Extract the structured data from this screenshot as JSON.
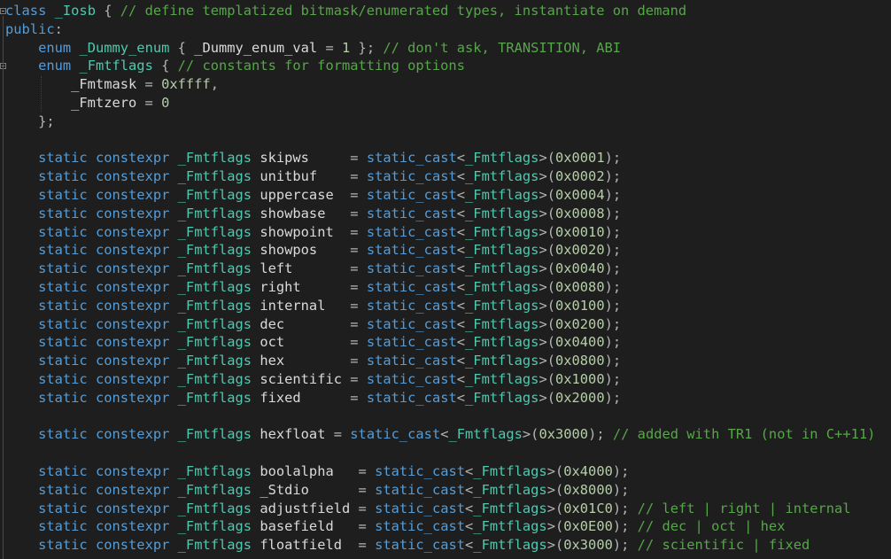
{
  "editor": {
    "colors": {
      "background": "#1e1e1e",
      "keyword": "#569cd6",
      "type": "#4ec9b0",
      "comment": "#57a64a",
      "number": "#b5cea8",
      "text": "#dadada"
    },
    "lines": [
      [
        [
          "kw",
          "class"
        ],
        [
          "var",
          " "
        ],
        [
          "type",
          "_Iosb"
        ],
        [
          "punc",
          " { "
        ],
        [
          "com",
          "// define templatized bitmask/enumerated types, instantiate on demand"
        ]
      ],
      [
        [
          "kw",
          "public"
        ],
        [
          "punc",
          ":"
        ]
      ],
      [
        [
          "var",
          "    "
        ],
        [
          "kw",
          "enum"
        ],
        [
          "var",
          " "
        ],
        [
          "type",
          "_Dummy_enum"
        ],
        [
          "punc",
          " { "
        ],
        [
          "var",
          "_Dummy_enum_val"
        ],
        [
          "punc",
          " = "
        ],
        [
          "num",
          "1"
        ],
        [
          "punc",
          " }; "
        ],
        [
          "com",
          "// don't ask, TRANSITION, ABI"
        ]
      ],
      [
        [
          "var",
          "    "
        ],
        [
          "kw",
          "enum"
        ],
        [
          "var",
          " "
        ],
        [
          "type",
          "_Fmtflags"
        ],
        [
          "punc",
          " { "
        ],
        [
          "com",
          "// constants for formatting options"
        ]
      ],
      [
        [
          "var",
          "        _Fmtmask"
        ],
        [
          "punc",
          " = "
        ],
        [
          "num",
          "0xffff"
        ],
        [
          "punc",
          ","
        ]
      ],
      [
        [
          "var",
          "        _Fmtzero"
        ],
        [
          "punc",
          " = "
        ],
        [
          "num",
          "0"
        ]
      ],
      [
        [
          "punc",
          "    };"
        ]
      ],
      [],
      [
        [
          "var",
          "    "
        ],
        [
          "kw",
          "static"
        ],
        [
          "var",
          " "
        ],
        [
          "kw",
          "constexpr"
        ],
        [
          "var",
          " "
        ],
        [
          "type",
          "_Fmtflags"
        ],
        [
          "var",
          " skipws     "
        ],
        [
          "punc",
          "= "
        ],
        [
          "kw",
          "static_cast"
        ],
        [
          "punc",
          "<"
        ],
        [
          "type",
          "_Fmtflags"
        ],
        [
          "punc",
          ">("
        ],
        [
          "num",
          "0x0001"
        ],
        [
          "punc",
          ");"
        ]
      ],
      [
        [
          "var",
          "    "
        ],
        [
          "kw",
          "static"
        ],
        [
          "var",
          " "
        ],
        [
          "kw",
          "constexpr"
        ],
        [
          "var",
          " "
        ],
        [
          "type",
          "_Fmtflags"
        ],
        [
          "var",
          " unitbuf    "
        ],
        [
          "punc",
          "= "
        ],
        [
          "kw",
          "static_cast"
        ],
        [
          "punc",
          "<"
        ],
        [
          "type",
          "_Fmtflags"
        ],
        [
          "punc",
          ">("
        ],
        [
          "num",
          "0x0002"
        ],
        [
          "punc",
          ");"
        ]
      ],
      [
        [
          "var",
          "    "
        ],
        [
          "kw",
          "static"
        ],
        [
          "var",
          " "
        ],
        [
          "kw",
          "constexpr"
        ],
        [
          "var",
          " "
        ],
        [
          "type",
          "_Fmtflags"
        ],
        [
          "var",
          " uppercase  "
        ],
        [
          "punc",
          "= "
        ],
        [
          "kw",
          "static_cast"
        ],
        [
          "punc",
          "<"
        ],
        [
          "type",
          "_Fmtflags"
        ],
        [
          "punc",
          ">("
        ],
        [
          "num",
          "0x0004"
        ],
        [
          "punc",
          ");"
        ]
      ],
      [
        [
          "var",
          "    "
        ],
        [
          "kw",
          "static"
        ],
        [
          "var",
          " "
        ],
        [
          "kw",
          "constexpr"
        ],
        [
          "var",
          " "
        ],
        [
          "type",
          "_Fmtflags"
        ],
        [
          "var",
          " showbase   "
        ],
        [
          "punc",
          "= "
        ],
        [
          "kw",
          "static_cast"
        ],
        [
          "punc",
          "<"
        ],
        [
          "type",
          "_Fmtflags"
        ],
        [
          "punc",
          ">("
        ],
        [
          "num",
          "0x0008"
        ],
        [
          "punc",
          ");"
        ]
      ],
      [
        [
          "var",
          "    "
        ],
        [
          "kw",
          "static"
        ],
        [
          "var",
          " "
        ],
        [
          "kw",
          "constexpr"
        ],
        [
          "var",
          " "
        ],
        [
          "type",
          "_Fmtflags"
        ],
        [
          "var",
          " showpoint  "
        ],
        [
          "punc",
          "= "
        ],
        [
          "kw",
          "static_cast"
        ],
        [
          "punc",
          "<"
        ],
        [
          "type",
          "_Fmtflags"
        ],
        [
          "punc",
          ">("
        ],
        [
          "num",
          "0x0010"
        ],
        [
          "punc",
          ");"
        ]
      ],
      [
        [
          "var",
          "    "
        ],
        [
          "kw",
          "static"
        ],
        [
          "var",
          " "
        ],
        [
          "kw",
          "constexpr"
        ],
        [
          "var",
          " "
        ],
        [
          "type",
          "_Fmtflags"
        ],
        [
          "var",
          " showpos    "
        ],
        [
          "punc",
          "= "
        ],
        [
          "kw",
          "static_cast"
        ],
        [
          "punc",
          "<"
        ],
        [
          "type",
          "_Fmtflags"
        ],
        [
          "punc",
          ">("
        ],
        [
          "num",
          "0x0020"
        ],
        [
          "punc",
          ");"
        ]
      ],
      [
        [
          "var",
          "    "
        ],
        [
          "kw",
          "static"
        ],
        [
          "var",
          " "
        ],
        [
          "kw",
          "constexpr"
        ],
        [
          "var",
          " "
        ],
        [
          "type",
          "_Fmtflags"
        ],
        [
          "var",
          " left       "
        ],
        [
          "punc",
          "= "
        ],
        [
          "kw",
          "static_cast"
        ],
        [
          "punc",
          "<"
        ],
        [
          "type",
          "_Fmtflags"
        ],
        [
          "punc",
          ">("
        ],
        [
          "num",
          "0x0040"
        ],
        [
          "punc",
          ");"
        ]
      ],
      [
        [
          "var",
          "    "
        ],
        [
          "kw",
          "static"
        ],
        [
          "var",
          " "
        ],
        [
          "kw",
          "constexpr"
        ],
        [
          "var",
          " "
        ],
        [
          "type",
          "_Fmtflags"
        ],
        [
          "var",
          " right      "
        ],
        [
          "punc",
          "= "
        ],
        [
          "kw",
          "static_cast"
        ],
        [
          "punc",
          "<"
        ],
        [
          "type",
          "_Fmtflags"
        ],
        [
          "punc",
          ">("
        ],
        [
          "num",
          "0x0080"
        ],
        [
          "punc",
          ");"
        ]
      ],
      [
        [
          "var",
          "    "
        ],
        [
          "kw",
          "static"
        ],
        [
          "var",
          " "
        ],
        [
          "kw",
          "constexpr"
        ],
        [
          "var",
          " "
        ],
        [
          "type",
          "_Fmtflags"
        ],
        [
          "var",
          " internal   "
        ],
        [
          "punc",
          "= "
        ],
        [
          "kw",
          "static_cast"
        ],
        [
          "punc",
          "<"
        ],
        [
          "type",
          "_Fmtflags"
        ],
        [
          "punc",
          ">("
        ],
        [
          "num",
          "0x0100"
        ],
        [
          "punc",
          ");"
        ]
      ],
      [
        [
          "var",
          "    "
        ],
        [
          "kw",
          "static"
        ],
        [
          "var",
          " "
        ],
        [
          "kw",
          "constexpr"
        ],
        [
          "var",
          " "
        ],
        [
          "type",
          "_Fmtflags"
        ],
        [
          "var",
          " dec        "
        ],
        [
          "punc",
          "= "
        ],
        [
          "kw",
          "static_cast"
        ],
        [
          "punc",
          "<"
        ],
        [
          "type",
          "_Fmtflags"
        ],
        [
          "punc",
          ">("
        ],
        [
          "num",
          "0x0200"
        ],
        [
          "punc",
          ");"
        ]
      ],
      [
        [
          "var",
          "    "
        ],
        [
          "kw",
          "static"
        ],
        [
          "var",
          " "
        ],
        [
          "kw",
          "constexpr"
        ],
        [
          "var",
          " "
        ],
        [
          "type",
          "_Fmtflags"
        ],
        [
          "var",
          " oct        "
        ],
        [
          "punc",
          "= "
        ],
        [
          "kw",
          "static_cast"
        ],
        [
          "punc",
          "<"
        ],
        [
          "type",
          "_Fmtflags"
        ],
        [
          "punc",
          ">("
        ],
        [
          "num",
          "0x0400"
        ],
        [
          "punc",
          ");"
        ]
      ],
      [
        [
          "var",
          "    "
        ],
        [
          "kw",
          "static"
        ],
        [
          "var",
          " "
        ],
        [
          "kw",
          "constexpr"
        ],
        [
          "var",
          " "
        ],
        [
          "type",
          "_Fmtflags"
        ],
        [
          "var",
          " hex        "
        ],
        [
          "punc",
          "= "
        ],
        [
          "kw",
          "static_cast"
        ],
        [
          "punc",
          "<"
        ],
        [
          "type",
          "_Fmtflags"
        ],
        [
          "punc",
          ">("
        ],
        [
          "num",
          "0x0800"
        ],
        [
          "punc",
          ");"
        ]
      ],
      [
        [
          "var",
          "    "
        ],
        [
          "kw",
          "static"
        ],
        [
          "var",
          " "
        ],
        [
          "kw",
          "constexpr"
        ],
        [
          "var",
          " "
        ],
        [
          "type",
          "_Fmtflags"
        ],
        [
          "var",
          " scientific "
        ],
        [
          "punc",
          "= "
        ],
        [
          "kw",
          "static_cast"
        ],
        [
          "punc",
          "<"
        ],
        [
          "type",
          "_Fmtflags"
        ],
        [
          "punc",
          ">("
        ],
        [
          "num",
          "0x1000"
        ],
        [
          "punc",
          ");"
        ]
      ],
      [
        [
          "var",
          "    "
        ],
        [
          "kw",
          "static"
        ],
        [
          "var",
          " "
        ],
        [
          "kw",
          "constexpr"
        ],
        [
          "var",
          " "
        ],
        [
          "type",
          "_Fmtflags"
        ],
        [
          "var",
          " fixed      "
        ],
        [
          "punc",
          "= "
        ],
        [
          "kw",
          "static_cast"
        ],
        [
          "punc",
          "<"
        ],
        [
          "type",
          "_Fmtflags"
        ],
        [
          "punc",
          ">("
        ],
        [
          "num",
          "0x2000"
        ],
        [
          "punc",
          ");"
        ]
      ],
      [],
      [
        [
          "var",
          "    "
        ],
        [
          "kw",
          "static"
        ],
        [
          "var",
          " "
        ],
        [
          "kw",
          "constexpr"
        ],
        [
          "var",
          " "
        ],
        [
          "type",
          "_Fmtflags"
        ],
        [
          "var",
          " hexfloat "
        ],
        [
          "punc",
          "= "
        ],
        [
          "kw",
          "static_cast"
        ],
        [
          "punc",
          "<"
        ],
        [
          "type",
          "_Fmtflags"
        ],
        [
          "punc",
          ">("
        ],
        [
          "num",
          "0x3000"
        ],
        [
          "punc",
          "); "
        ],
        [
          "com",
          "// added with TR1 (not in C++11)"
        ]
      ],
      [],
      [
        [
          "var",
          "    "
        ],
        [
          "kw",
          "static"
        ],
        [
          "var",
          " "
        ],
        [
          "kw",
          "constexpr"
        ],
        [
          "var",
          " "
        ],
        [
          "type",
          "_Fmtflags"
        ],
        [
          "var",
          " boolalpha   "
        ],
        [
          "punc",
          "= "
        ],
        [
          "kw",
          "static_cast"
        ],
        [
          "punc",
          "<"
        ],
        [
          "type",
          "_Fmtflags"
        ],
        [
          "punc",
          ">("
        ],
        [
          "num",
          "0x4000"
        ],
        [
          "punc",
          ");"
        ]
      ],
      [
        [
          "var",
          "    "
        ],
        [
          "kw",
          "static"
        ],
        [
          "var",
          " "
        ],
        [
          "kw",
          "constexpr"
        ],
        [
          "var",
          " "
        ],
        [
          "type",
          "_Fmtflags"
        ],
        [
          "var",
          " _Stdio      "
        ],
        [
          "punc",
          "= "
        ],
        [
          "kw",
          "static_cast"
        ],
        [
          "punc",
          "<"
        ],
        [
          "type",
          "_Fmtflags"
        ],
        [
          "punc",
          ">("
        ],
        [
          "num",
          "0x8000"
        ],
        [
          "punc",
          ");"
        ]
      ],
      [
        [
          "var",
          "    "
        ],
        [
          "kw",
          "static"
        ],
        [
          "var",
          " "
        ],
        [
          "kw",
          "constexpr"
        ],
        [
          "var",
          " "
        ],
        [
          "type",
          "_Fmtflags"
        ],
        [
          "var",
          " adjustfield "
        ],
        [
          "punc",
          "= "
        ],
        [
          "kw",
          "static_cast"
        ],
        [
          "punc",
          "<"
        ],
        [
          "type",
          "_Fmtflags"
        ],
        [
          "punc",
          ">("
        ],
        [
          "num",
          "0x01C0"
        ],
        [
          "punc",
          "); "
        ],
        [
          "com",
          "// left | right | internal"
        ]
      ],
      [
        [
          "var",
          "    "
        ],
        [
          "kw",
          "static"
        ],
        [
          "var",
          " "
        ],
        [
          "kw",
          "constexpr"
        ],
        [
          "var",
          " "
        ],
        [
          "type",
          "_Fmtflags"
        ],
        [
          "var",
          " basefield   "
        ],
        [
          "punc",
          "= "
        ],
        [
          "kw",
          "static_cast"
        ],
        [
          "punc",
          "<"
        ],
        [
          "type",
          "_Fmtflags"
        ],
        [
          "punc",
          ">("
        ],
        [
          "num",
          "0x0E00"
        ],
        [
          "punc",
          "); "
        ],
        [
          "com",
          "// dec | oct | hex"
        ]
      ],
      [
        [
          "var",
          "    "
        ],
        [
          "kw",
          "static"
        ],
        [
          "var",
          " "
        ],
        [
          "kw",
          "constexpr"
        ],
        [
          "var",
          " "
        ],
        [
          "type",
          "_Fmtflags"
        ],
        [
          "var",
          " floatfield  "
        ],
        [
          "punc",
          "= "
        ],
        [
          "kw",
          "static_cast"
        ],
        [
          "punc",
          "<"
        ],
        [
          "type",
          "_Fmtflags"
        ],
        [
          "punc",
          ">("
        ],
        [
          "num",
          "0x3000"
        ],
        [
          "punc",
          "); "
        ],
        [
          "com",
          "// scientific | fixed"
        ]
      ]
    ]
  }
}
